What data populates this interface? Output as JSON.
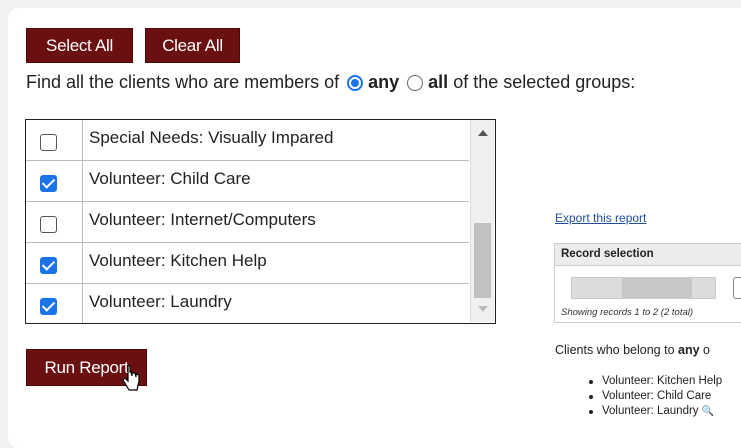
{
  "toolbar": {
    "select_all_label": "Select All",
    "clear_all_label": "Clear All"
  },
  "criteria": {
    "prefix": "Find all the clients who are members of",
    "option_any": "any",
    "option_all": "all",
    "suffix": "of the selected groups:",
    "selected": "any"
  },
  "groups": [
    {
      "label": "Special Needs: Visually Impared",
      "checked": false
    },
    {
      "label": "Volunteer: Child Care",
      "checked": true
    },
    {
      "label": "Volunteer: Internet/Computers",
      "checked": false
    },
    {
      "label": "Volunteer: Kitchen Help",
      "checked": true
    },
    {
      "label": "Volunteer: Laundry",
      "checked": true
    }
  ],
  "run_report_label": "Run Report",
  "preview": {
    "export_link": "Export this report",
    "record_selection_title": "Record selection",
    "status_text": "Showing records 1 to 2 (2 total)",
    "clients_prefix": "Clients who belong to",
    "clients_bold": "any",
    "clients_rest": "o",
    "list": [
      "Volunteer: Kitchen Help",
      "Volunteer: Child Care",
      "Volunteer: Laundry"
    ]
  },
  "colors": {
    "button_bg": "#6b1010",
    "accent": "#1a73e8",
    "link": "#1f4e9e"
  }
}
